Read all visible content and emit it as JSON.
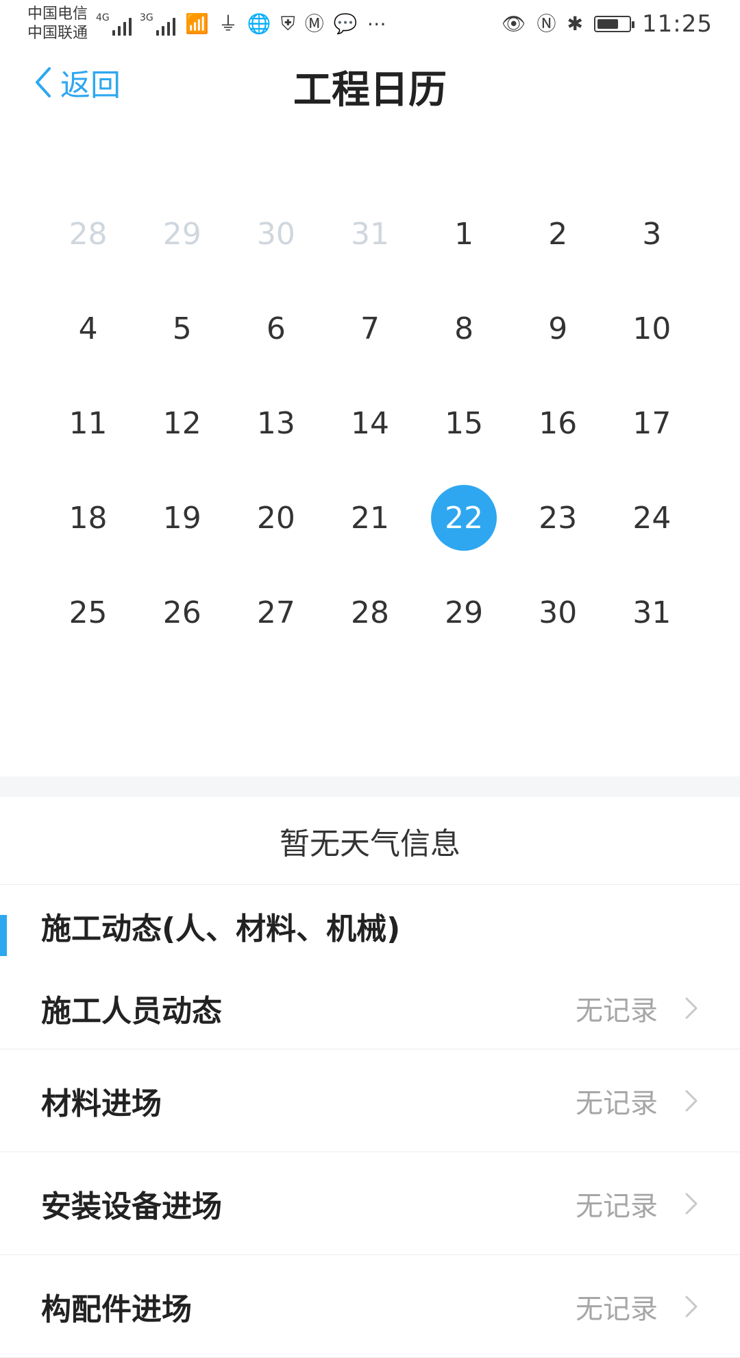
{
  "status_bar": {
    "carriers": [
      "中国电信",
      "中国联通"
    ],
    "network": [
      "4G",
      "3G"
    ],
    "time": "11:25"
  },
  "header": {
    "back_label": "返回",
    "title": "工程日历"
  },
  "calendar": {
    "weeks": [
      [
        {
          "d": "28",
          "out": true
        },
        {
          "d": "29",
          "out": true
        },
        {
          "d": "30",
          "out": true
        },
        {
          "d": "31",
          "out": true
        },
        {
          "d": "1"
        },
        {
          "d": "2"
        },
        {
          "d": "3"
        }
      ],
      [
        {
          "d": "4"
        },
        {
          "d": "5"
        },
        {
          "d": "6"
        },
        {
          "d": "7"
        },
        {
          "d": "8"
        },
        {
          "d": "9"
        },
        {
          "d": "10"
        }
      ],
      [
        {
          "d": "11"
        },
        {
          "d": "12"
        },
        {
          "d": "13"
        },
        {
          "d": "14"
        },
        {
          "d": "15"
        },
        {
          "d": "16"
        },
        {
          "d": "17"
        }
      ],
      [
        {
          "d": "18"
        },
        {
          "d": "19"
        },
        {
          "d": "20"
        },
        {
          "d": "21"
        },
        {
          "d": "22",
          "selected": true
        },
        {
          "d": "23"
        },
        {
          "d": "24"
        }
      ],
      [
        {
          "d": "25"
        },
        {
          "d": "26"
        },
        {
          "d": "27"
        },
        {
          "d": "28"
        },
        {
          "d": "29"
        },
        {
          "d": "30"
        },
        {
          "d": "31"
        }
      ]
    ],
    "selected_day": "22"
  },
  "weather": {
    "text": "暂无天气信息"
  },
  "construction": {
    "title": "施工动态(人、材料、机械)",
    "items": [
      {
        "label": "施工人员动态",
        "status": "无记录"
      },
      {
        "label": "材料进场",
        "status": "无记录"
      },
      {
        "label": "安装设备进场",
        "status": "无记录"
      },
      {
        "label": "构配件进场",
        "status": "无记录"
      }
    ]
  },
  "colors": {
    "accent": "#2EA7F0",
    "muted": "#A6A6A6"
  }
}
